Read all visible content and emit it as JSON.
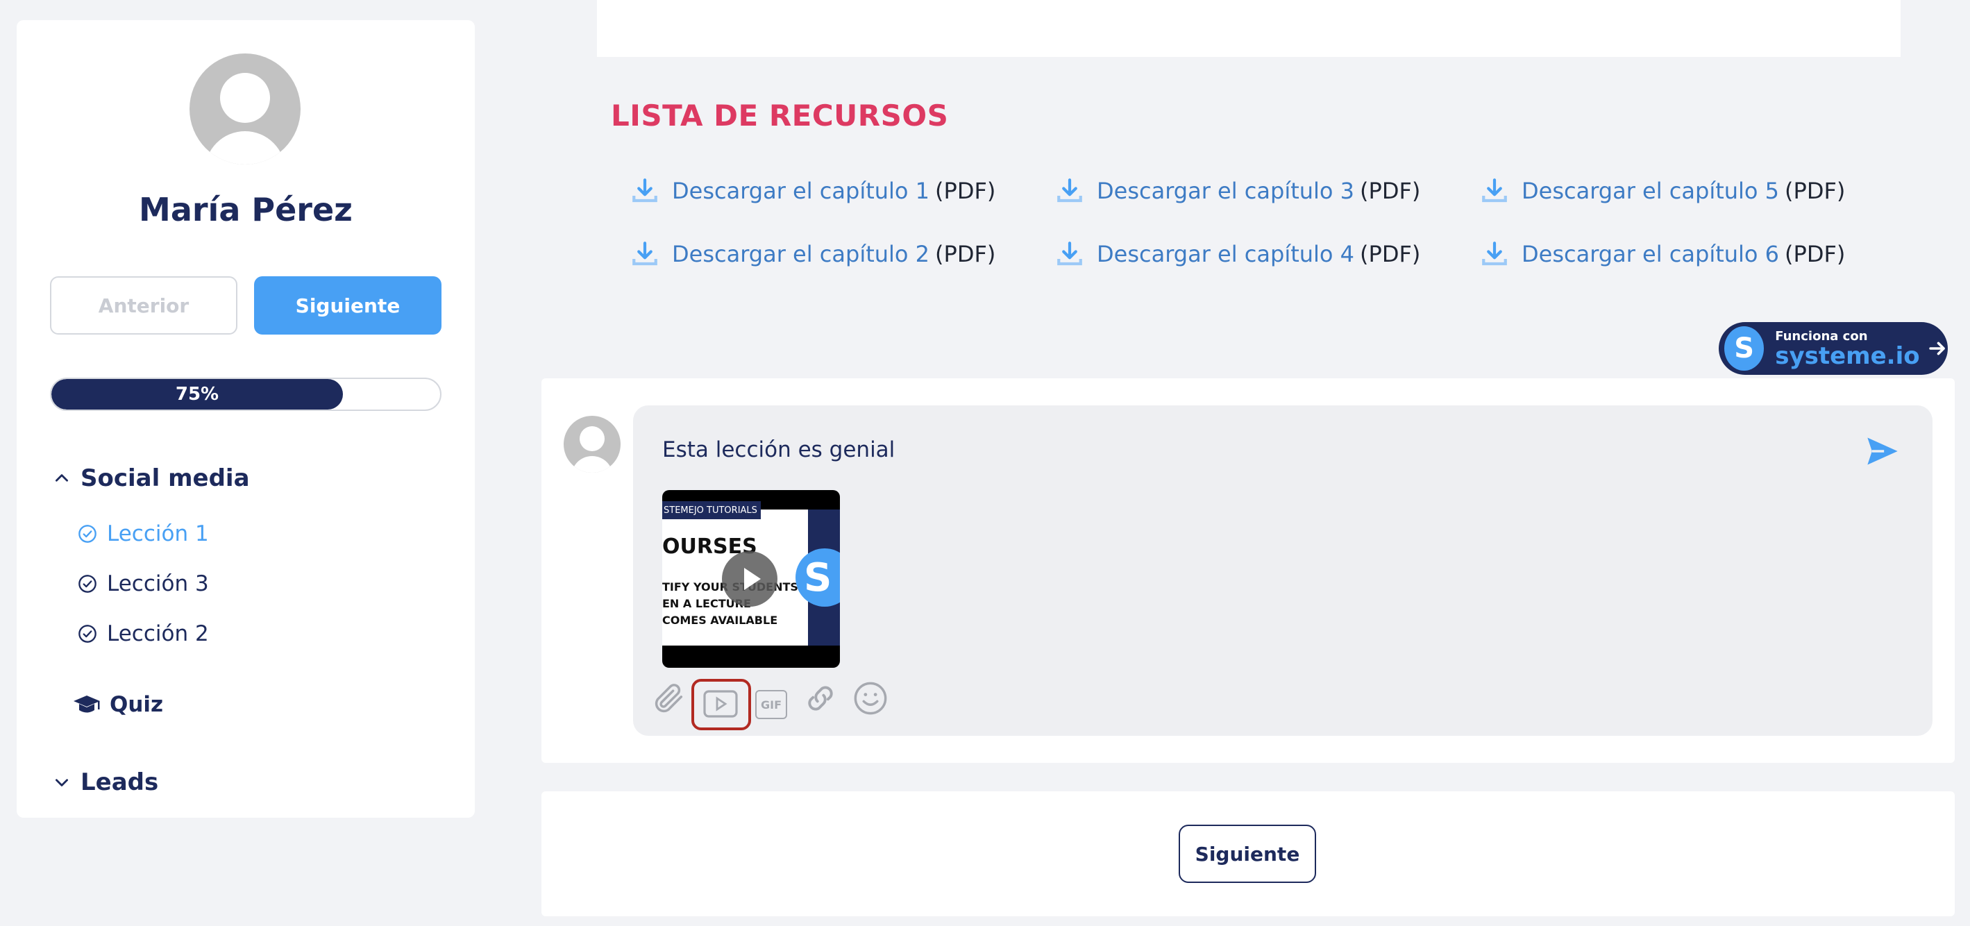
{
  "user": {
    "name": "María Pérez"
  },
  "nav": {
    "prev_label": "Anterior",
    "next_label": "Siguiente"
  },
  "progress": {
    "value": 0.75,
    "label": "75%"
  },
  "sections": [
    {
      "title": "Social media",
      "expanded": true
    },
    {
      "title": "Leads",
      "expanded": false
    }
  ],
  "lessons": [
    {
      "label": "Lección 1",
      "active": true
    },
    {
      "label": "Lección 3",
      "active": false
    },
    {
      "label": "Lección 2",
      "active": false
    }
  ],
  "quiz": {
    "label": "Quiz"
  },
  "resources": {
    "title": "LISTA DE RECURSOS",
    "items": [
      {
        "link": "Descargar el capítulo 1",
        "suffix": "(PDF)"
      },
      {
        "link": "Descargar el capítulo 2",
        "suffix": "(PDF)"
      },
      {
        "link": "Descargar el capítulo 3",
        "suffix": "(PDF)"
      },
      {
        "link": "Descargar el capítulo 4",
        "suffix": "(PDF)"
      },
      {
        "link": "Descargar el capítulo 5",
        "suffix": "(PDF)"
      },
      {
        "link": "Descargar el capítulo 6",
        "suffix": "(PDF)"
      }
    ]
  },
  "badge": {
    "small": "Funciona con",
    "brand": "systeme.io",
    "logo": "S"
  },
  "comment": {
    "text": "Esta lección es genial",
    "video": {
      "strip": "STEMEJO TUTORIALS",
      "headline": "OURSES",
      "lines": [
        "TIFY YOUR STUDENTS",
        "EN A LECTURE",
        "COMES AVAILABLE"
      ],
      "logo": "S"
    },
    "gif_label": "GIF"
  },
  "bottom": {
    "next_label": "Siguiente"
  },
  "colors": {
    "accent": "#48a0f4",
    "navy": "#1d2a5c",
    "title_red": "#dd3a62",
    "link": "#3d7bc4",
    "highlight": "#b22a22"
  },
  "icons": [
    "chevron-up-icon",
    "chevron-down-icon",
    "check-circle-icon",
    "graduation-cap-icon",
    "download-icon",
    "send-icon",
    "paperclip-icon",
    "video-icon",
    "gif-icon",
    "link-icon",
    "emoji-icon",
    "arrow-right-icon",
    "play-icon"
  ]
}
